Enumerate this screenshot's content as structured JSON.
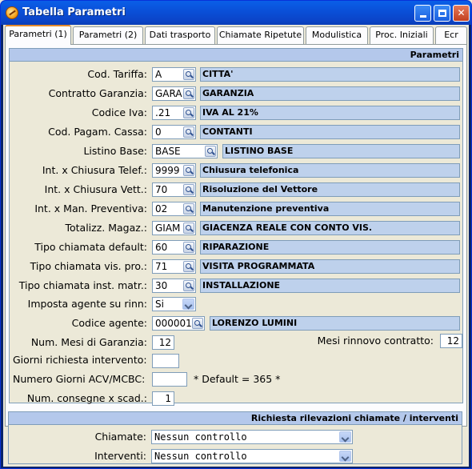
{
  "window": {
    "title": "Tabella Parametri"
  },
  "tabs": [
    {
      "label": "Parametri (1)"
    },
    {
      "label": "Parametri (2)"
    },
    {
      "label": "Dati trasporto"
    },
    {
      "label": "Chiamate Ripetute"
    },
    {
      "label": "Modulistica"
    },
    {
      "label": "Proc. Iniziali"
    },
    {
      "label": "Ecr"
    }
  ],
  "group_parametri": {
    "title": "Parametri"
  },
  "rows": [
    {
      "label": "Cod. Tariffa:",
      "code": "A",
      "desc": "CITTA'"
    },
    {
      "label": "Contratto Garanzia:",
      "code": "GARA",
      "desc": "GARANZIA"
    },
    {
      "label": "Codice Iva:",
      "code": ".21",
      "desc": "IVA AL 21%"
    },
    {
      "label": "Cod. Pagam. Cassa:",
      "code": "0",
      "desc": "CONTANTI"
    },
    {
      "label": "Listino Base:",
      "code": "BASE",
      "desc": "LISTINO BASE"
    },
    {
      "label": "Int. x Chiusura Telef.:",
      "code": "9999",
      "desc": "Chiusura telefonica"
    },
    {
      "label": "Int. x Chiusura Vett.:",
      "code": "70",
      "desc": "Risoluzione del Vettore"
    },
    {
      "label": "Int. x Man. Preventiva:",
      "code": "02",
      "desc": "Manutenzione preventiva"
    },
    {
      "label": "Totalizz. Magaz.:",
      "code": "GIAM",
      "desc": "GIACENZA REALE CON CONTO VIS."
    },
    {
      "label": "Tipo chiamata default:",
      "code": "60",
      "desc": "RIPARAZIONE"
    },
    {
      "label": "Tipo chiamata vis. pro.:",
      "code": "71",
      "desc": "VISITA PROGRAMMATA"
    },
    {
      "label": "Tipo chiamata inst. matr.:",
      "code": "30",
      "desc": "INSTALLAZIONE"
    }
  ],
  "imposta_agente": {
    "label": "Imposta agente su rinn:",
    "value": "Si"
  },
  "codice_agente": {
    "label": "Codice agente:",
    "code": "000001",
    "desc": "LORENZO LUMINI"
  },
  "mesi_garanzia": {
    "label": "Num. Mesi di Garanzia:",
    "value": "12"
  },
  "mesi_rinnovo": {
    "label": "Mesi rinnovo contratto:",
    "value": "12"
  },
  "giorni_richiesta": {
    "label": "Giorni richiesta intervento:",
    "value": ""
  },
  "giorni_acv": {
    "label": "Numero Giorni ACV/MCBC:",
    "value": "",
    "note": "* Default = 365 *"
  },
  "consegne": {
    "label": "Num. consegne x scad.:",
    "value": "1"
  },
  "group_rilevazioni": {
    "title": "Richiesta rilevazioni chiamate / interventi"
  },
  "chiamate": {
    "label": "Chiamate:",
    "value": "Nessun controllo"
  },
  "interventi": {
    "label": "Interventi:",
    "value": "Nessun controllo"
  }
}
